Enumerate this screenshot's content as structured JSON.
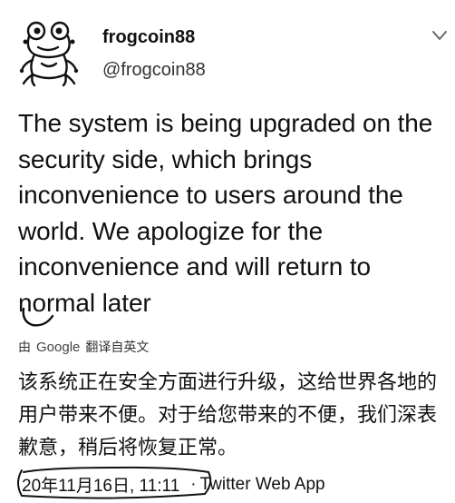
{
  "user": {
    "display_name": "frogcoin88",
    "handle": "@frogcoin88",
    "avatar_icon": "frog-icon"
  },
  "menu_icon": "chevron-down-icon",
  "tweet": {
    "text": "The system is being upgraded on the security side, which brings inconvenience to users around the world. We apologize for the inconvenience and will return to normal later",
    "translate_prefix": "由",
    "translate_brand": "Google",
    "translate_label": "翻译自英文",
    "translated_text": "该系统正在安全方面进行升级，这给世界各地的用户带来不便。对于给您带来的不便，我们深表歉意，稍后将恢复正常。",
    "timestamp": "20年11月16日, 11:11",
    "separator": "·",
    "source": "Twitter Web App"
  },
  "colors": {
    "text": "#111111",
    "background": "#ffffff"
  }
}
